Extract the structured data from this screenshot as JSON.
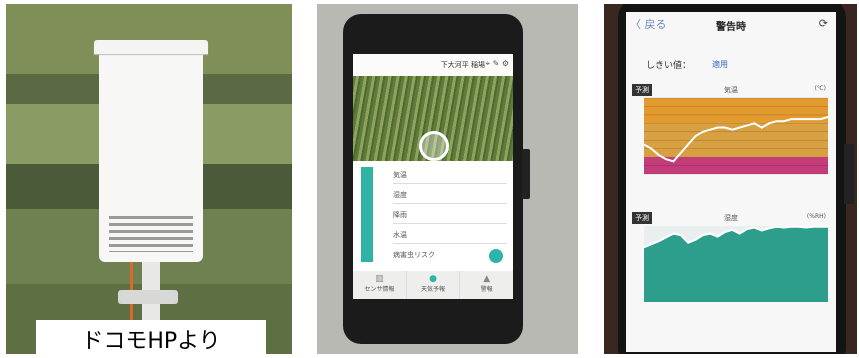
{
  "panel1": {
    "caption": "ドコモHPより"
  },
  "panel2": {
    "screen": {
      "header_title": "下大河平 稲場",
      "header_icons": [
        "location-pin-icon",
        "edit-icon",
        "gear-icon"
      ],
      "rows": [
        {
          "label": "気温",
          "value": ""
        },
        {
          "label": "湿度",
          "value": ""
        },
        {
          "label": "降雨",
          "value": ""
        },
        {
          "label": "水温",
          "value": ""
        },
        {
          "label": "病害虫リスク",
          "value": ""
        }
      ],
      "tabs": [
        {
          "label": "センサ情報",
          "icon": "sensor-icon"
        },
        {
          "label": "天気予報",
          "icon": "weather-icon"
        },
        {
          "label": "警報",
          "icon": "alert-icon"
        }
      ]
    }
  },
  "panel3": {
    "screen": {
      "back_label": "〈 戻る",
      "title": "警告時",
      "threshold_label": "しきい値：",
      "threshold_value": "適用",
      "charts": [
        {
          "tag": "予測",
          "title": "気温",
          "unit": "(℃)",
          "colors": {
            "top": "#e39a2f",
            "mid": "#d8a040",
            "bottom": "#c43d7a"
          },
          "chart_data": {
            "type": "line",
            "ylim": [
              0,
              18
            ],
            "y_ticks": [
              0,
              2,
              4,
              6,
              8,
              10,
              12,
              14,
              16,
              18
            ],
            "values": [
              7,
              6,
              4.5,
              3.5,
              3,
              5,
              7,
              9,
              10,
              10.5,
              11,
              11,
              10.5,
              11,
              11.5,
              12,
              11,
              12,
              12.5,
              12.5,
              13,
              13,
              13,
              13,
              13,
              13.5
            ]
          }
        },
        {
          "tag": "予測",
          "title": "湿度",
          "unit": "(%RH)",
          "colors": {
            "fill": "#2d9e8c"
          },
          "chart_data": {
            "type": "line",
            "ylim": [
              0,
              100
            ],
            "values": [
              72,
              76,
              80,
              85,
              90,
              88,
              78,
              82,
              88,
              90,
              86,
              92,
              95,
              90,
              96,
              98,
              94,
              97,
              99,
              98,
              99,
              99,
              98,
              99,
              99,
              99
            ]
          }
        }
      ]
    }
  }
}
